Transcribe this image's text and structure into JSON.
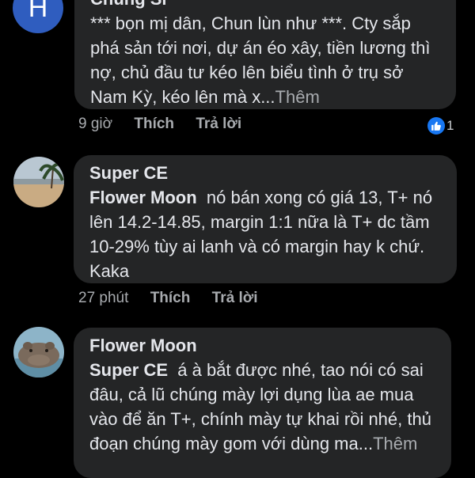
{
  "comments": [
    {
      "avatar_letter": "H",
      "author": "Chung Sĩ",
      "text": "*** bọn mị dân, Chun lùn như ***. Cty sắp phá sản tới nơi, dự án éo xây, tiền lương thì nợ, chủ đầu tư kéo lên biểu tình ở trụ sở Nam Kỳ, kéo lên mà x...",
      "more": "Thêm",
      "time": "9 giờ",
      "like_label": "Thích",
      "reply_label": "Trả lời",
      "reaction_count": "1"
    },
    {
      "author": "Super CE",
      "tag": "Flower Moon",
      "text": "nó bán xong có giá 13, T+ nó lên 14.2-14.85, margin 1:1 nữa là T+ dc tầm 10-29% tùy ai lanh và có margin hay k chứ. Kaka",
      "time": "27 phút",
      "like_label": "Thích",
      "reply_label": "Trả lời"
    },
    {
      "author": "Flower Moon",
      "tag": "Super CE",
      "text": "á à bắt được nhé, tao nói có sai đâu, cả lũ chúng mày lợi dụng lùa ae mua vào để ăn T+, chính mày tự khai rồi nhé, thủ đoạn chúng mày gom với dùng ma...",
      "more": "Thêm"
    }
  ],
  "colors": {
    "background": "#000000",
    "bubble": "#242526",
    "text": "#e4e6eb",
    "muted": "#a8abaf",
    "like_blue": "#1877f2",
    "avatar_letter_bg": "#2f5dbf"
  },
  "icons": {
    "reaction": "thumbs-up-icon"
  }
}
